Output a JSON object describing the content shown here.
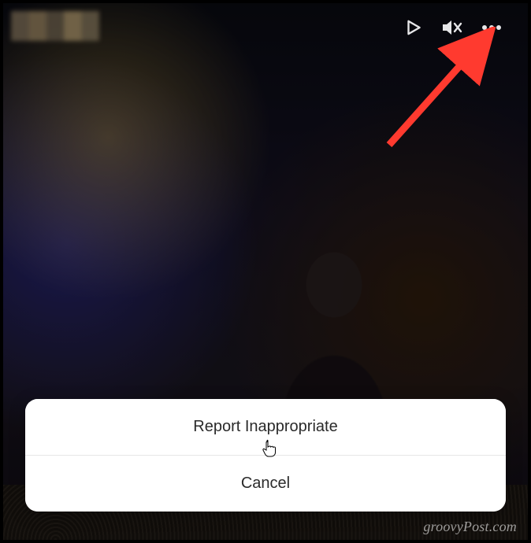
{
  "actionSheet": {
    "report_label": "Report Inappropriate",
    "cancel_label": "Cancel"
  },
  "watermark": "groovyPost.com",
  "icons": {
    "play": "play-icon",
    "mute": "mute-icon",
    "more": "more-icon"
  }
}
